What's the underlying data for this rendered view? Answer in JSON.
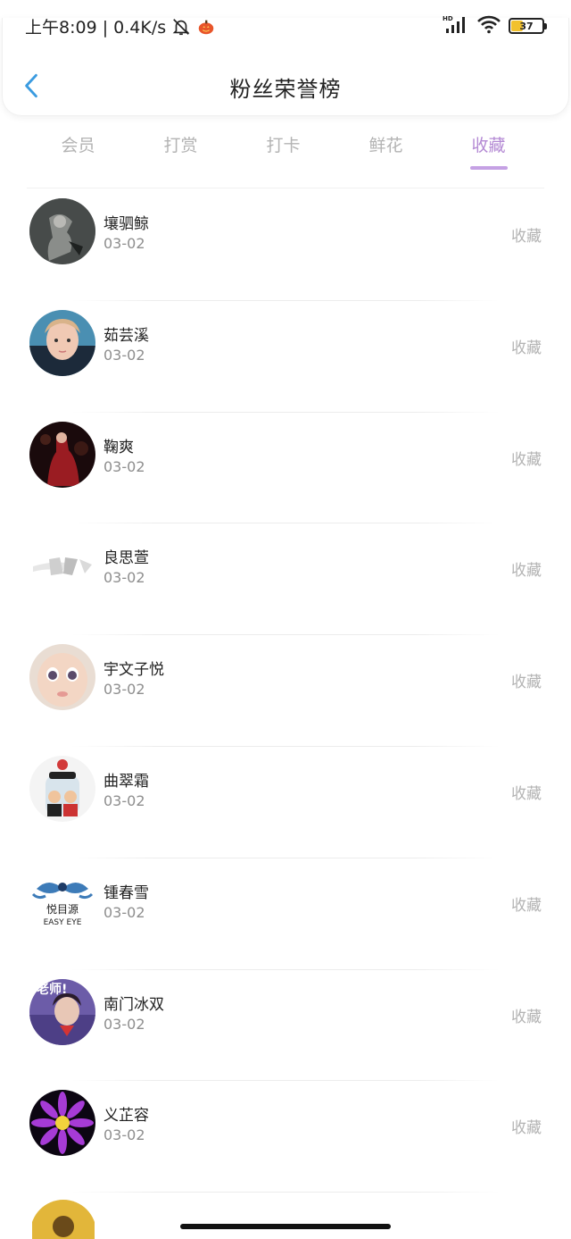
{
  "status_bar": {
    "time_text": "上午8:09 | 0.4K/s",
    "battery_level": "37",
    "battery_percent": 0.37
  },
  "header": {
    "title": "粉丝荣誉榜"
  },
  "tabs": [
    {
      "label": "会员",
      "active": false
    },
    {
      "label": "打赏",
      "active": false
    },
    {
      "label": "打卡",
      "active": false
    },
    {
      "label": "鲜花",
      "active": false
    },
    {
      "label": "收藏",
      "active": true
    }
  ],
  "colors": {
    "accent": "#b48ad4",
    "underline": "#c5a1e4",
    "back_arrow": "#3a9be0",
    "muted": "#b3b3b3"
  },
  "fans": [
    {
      "name": "壤驷鲸",
      "date": "03-02",
      "action": "收藏",
      "avatar": "gray-figure"
    },
    {
      "name": "茹芸溪",
      "date": "03-02",
      "action": "收藏",
      "avatar": "boy-portrait"
    },
    {
      "name": "鞠爽",
      "date": "03-02",
      "action": "收藏",
      "avatar": "red-dress"
    },
    {
      "name": "良思萱",
      "date": "03-02",
      "action": "收藏",
      "avatar": "sketch"
    },
    {
      "name": "宇文子悦",
      "date": "03-02",
      "action": "收藏",
      "avatar": "baby-face"
    },
    {
      "name": "曲翠霜",
      "date": "03-02",
      "action": "收藏",
      "avatar": "cartoon-jar"
    },
    {
      "name": "锺春雪",
      "date": "03-02",
      "action": "收藏",
      "avatar": "eye-logo",
      "avatar_text": [
        "悦目源",
        "EASY EYE"
      ]
    },
    {
      "name": "南门冰双",
      "date": "03-02",
      "action": "收藏",
      "avatar": "purple-stage",
      "avatar_text": [
        "老师!"
      ]
    },
    {
      "name": "义芷容",
      "date": "03-02",
      "action": "收藏",
      "avatar": "purple-flower"
    }
  ]
}
